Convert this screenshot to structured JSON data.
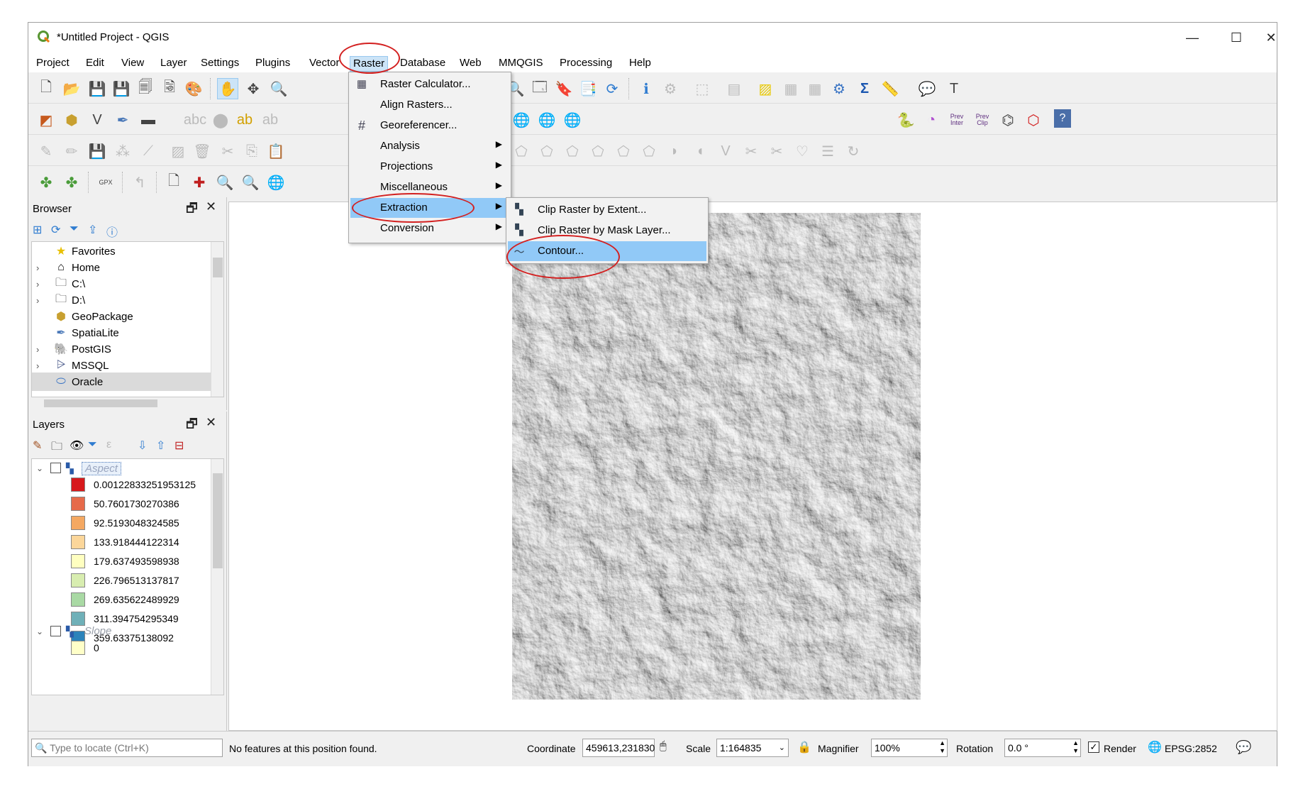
{
  "window": {
    "title": "*Untitled Project - QGIS",
    "controls": {
      "minimize": "—",
      "maximize": "☐",
      "close": "✕"
    }
  },
  "menubar": [
    "Project",
    "Edit",
    "View",
    "Layer",
    "Settings",
    "Plugins",
    "Vector",
    "Raster",
    "Database",
    "Web",
    "MMQGIS",
    "Processing",
    "Help"
  ],
  "raster_menu": {
    "items": [
      {
        "label": "Raster Calculator...",
        "icon": "calculator-icon",
        "submenu": false
      },
      {
        "label": "Align Rasters...",
        "icon": "",
        "submenu": false
      },
      {
        "label": "Georeferencer...",
        "icon": "grid-icon",
        "submenu": false
      },
      {
        "label": "Analysis",
        "icon": "",
        "submenu": true
      },
      {
        "label": "Projections",
        "icon": "",
        "submenu": true
      },
      {
        "label": "Miscellaneous",
        "icon": "",
        "submenu": true
      },
      {
        "label": "Extraction",
        "icon": "",
        "submenu": true
      },
      {
        "label": "Conversion",
        "icon": "",
        "submenu": true
      }
    ],
    "highlighted": "Extraction"
  },
  "extraction_submenu": {
    "items": [
      {
        "label": "Clip Raster by Extent...",
        "icon": "raster-clip-icon"
      },
      {
        "label": "Clip Raster by Mask Layer...",
        "icon": "raster-mask-icon"
      },
      {
        "label": "Contour...",
        "icon": "contour-icon"
      }
    ],
    "highlighted": "Contour..."
  },
  "toolbar": {
    "plugin_labels": {
      "prev_inter": "Prev Inter",
      "prev_clip": "Prev Clip"
    },
    "gpx_label": "GPX"
  },
  "browser": {
    "title": "Browser",
    "items": [
      {
        "label": "Favorites",
        "icon": "star-icon",
        "expandable": false
      },
      {
        "label": "Home",
        "icon": "home-folder-icon",
        "expandable": true
      },
      {
        "label": "C:\\",
        "icon": "drive-icon",
        "expandable": true
      },
      {
        "label": "D:\\",
        "icon": "drive-icon",
        "expandable": true
      },
      {
        "label": "GeoPackage",
        "icon": "geopackage-icon",
        "expandable": false
      },
      {
        "label": "SpatiaLite",
        "icon": "feather-icon",
        "expandable": false
      },
      {
        "label": "PostGIS",
        "icon": "elephant-icon",
        "expandable": true
      },
      {
        "label": "MSSQL",
        "icon": "mssql-icon",
        "expandable": true
      },
      {
        "label": "Oracle",
        "icon": "oracle-icon",
        "expandable": false
      }
    ]
  },
  "layers": {
    "title": "Layers",
    "aspect_layer": "Aspect",
    "aspect_legend": [
      {
        "value": "0.00122833251953125",
        "color": "#d7191c"
      },
      {
        "value": "50.7601730270386",
        "color": "#e66a4a"
      },
      {
        "value": "92.5193048324585",
        "color": "#f4a862"
      },
      {
        "value": "133.918444122314",
        "color": "#fbd69a"
      },
      {
        "value": "179.637493598938",
        "color": "#ffffc0"
      },
      {
        "value": "226.796513137817",
        "color": "#d8edb0"
      },
      {
        "value": "269.635622489929",
        "color": "#a9d9a4"
      },
      {
        "value": "311.394754295349",
        "color": "#6fb0b8"
      },
      {
        "value": "359.63375138092",
        "color": "#2b83ba"
      }
    ],
    "slope_layer": "Slope",
    "slope_legend": [
      {
        "value": "0",
        "color": "#ffffc8"
      }
    ]
  },
  "statusbar": {
    "locate_placeholder": "Type to locate (Ctrl+K)",
    "message": "No features at this position found.",
    "coordinate_label": "Coordinate",
    "coordinate_value": "459613,231830",
    "scale_label": "Scale",
    "scale_value": "1:164835",
    "magnifier_label": "Magnifier",
    "magnifier_value": "100%",
    "rotation_label": "Rotation",
    "rotation_value": "0.0 °",
    "render_label": "Render",
    "render_checked": true,
    "crs": "EPSG:2852"
  },
  "annotation_color": "#d32020"
}
